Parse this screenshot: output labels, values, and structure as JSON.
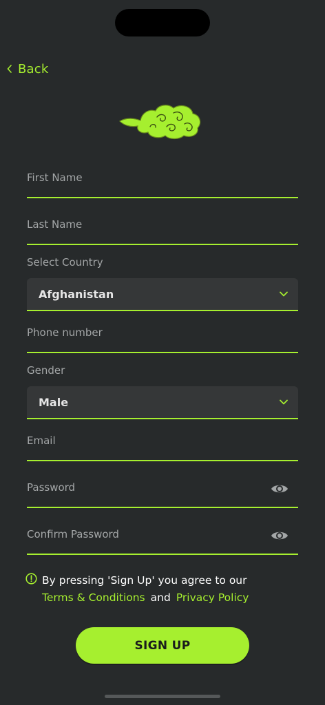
{
  "nav": {
    "back_label": "Back"
  },
  "colors": {
    "accent": "#a6ef2f",
    "background": "#272a2b",
    "field_fill": "#353738"
  },
  "form": {
    "first_name": {
      "placeholder": "First Name",
      "value": ""
    },
    "last_name": {
      "placeholder": "Last Name",
      "value": ""
    },
    "country": {
      "label": "Select Country",
      "selected": "Afghanistan"
    },
    "phone": {
      "placeholder": "Phone number",
      "value": ""
    },
    "gender": {
      "label": "Gender",
      "selected": "Male"
    },
    "email": {
      "placeholder": "Email",
      "value": ""
    },
    "password": {
      "placeholder": "Password",
      "value": ""
    },
    "confirm_password": {
      "placeholder": "Confirm Password",
      "value": ""
    }
  },
  "terms": {
    "notice": "By pressing 'Sign Up' you agree to our",
    "terms_link": "Terms & Conditions",
    "conjunction": "and",
    "privacy_link": "Privacy Policy"
  },
  "actions": {
    "signup_label": "SIGN UP"
  },
  "icons": {
    "back": "chevron-left-icon",
    "logo": "cloud-logo",
    "dropdown": "chevron-down-icon",
    "visibility": "eye-icon",
    "info": "info-circle-icon"
  }
}
